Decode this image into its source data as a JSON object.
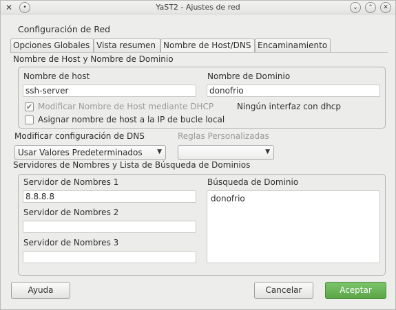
{
  "window": {
    "title": "YaST2 - Ajustes de red",
    "app_icon": "yast-tools-icon",
    "controls": [
      "minimize-icon",
      "maximize-icon",
      "close-icon"
    ]
  },
  "heading": "Configuración de Red",
  "tabs": [
    {
      "label": "Opciones Globales",
      "active": false
    },
    {
      "label": "Vista resumen",
      "active": false
    },
    {
      "label": "Nombre de Host/DNS",
      "active": true
    },
    {
      "label": "Encaminamiento",
      "active": false
    }
  ],
  "host_section": {
    "title": "Nombre de Host y Nombre de Dominio",
    "hostname_label": "Nombre de host",
    "hostname_value": "ssh-server",
    "domain_label": "Nombre de Dominio",
    "domain_value": "donofrio",
    "dhcp_checkbox_label": "Modificar Nombre de Host mediante DHCP",
    "dhcp_checked": true,
    "dhcp_status": "Ningún interfaz con dhcp",
    "loopback_checkbox_label": "Asignar nombre de host a la IP de bucle local",
    "loopback_checked": false
  },
  "dns_config": {
    "label": "Modificar configuración de DNS",
    "selected": "Usar Valores Predeterminados",
    "custom_rules_label": "Reglas Personalizadas",
    "custom_rules_value": ""
  },
  "servers_section": {
    "title": "Servidores de Nombres y Lista de Búsqueda de Dominios",
    "ns1_label": "Servidor de Nombres 1",
    "ns1_value": "8.8.8.8",
    "ns2_label": "Servidor de Nombres 2",
    "ns2_value": "",
    "ns3_label": "Servidor de Nombres 3",
    "ns3_value": "",
    "search_label": "Búsqueda de Dominio",
    "search_value": "donofrio"
  },
  "buttons": {
    "help": "Ayuda",
    "cancel": "Cancelar",
    "accept": "Aceptar"
  },
  "colors": {
    "accept_button": "#5ba648",
    "window_bg": "#ededec"
  }
}
